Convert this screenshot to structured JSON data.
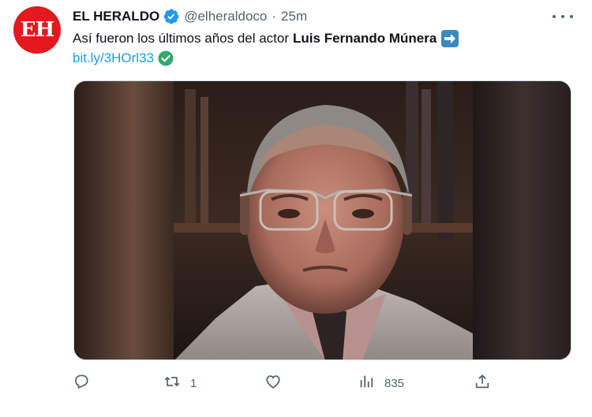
{
  "account": {
    "avatar_text": "EH",
    "display_name": "EL HERALDO",
    "handle": "@elheraldoco",
    "separator": "·",
    "time": "25m"
  },
  "tweet": {
    "text_prefix": "Así fueron los últimos años del actor",
    "text_bold": "Luis Fernando Múnera",
    "link": "bit.ly/3HOrl33"
  },
  "actions": {
    "retweet_count": "1",
    "views_count": "835"
  },
  "colors": {
    "avatar_red": "#e4181f",
    "verified_blue": "#1d9bf0",
    "link_blue": "#1d9bf0",
    "check_green": "#31a86c",
    "arrow_box": "#3b88c3",
    "muted": "#536471"
  },
  "icons": [
    "verified-badge-icon",
    "more-options-icon",
    "right-arrow-emoji-icon",
    "check-mark-icon",
    "reply-icon",
    "retweet-icon",
    "like-icon",
    "views-icon",
    "share-icon"
  ]
}
